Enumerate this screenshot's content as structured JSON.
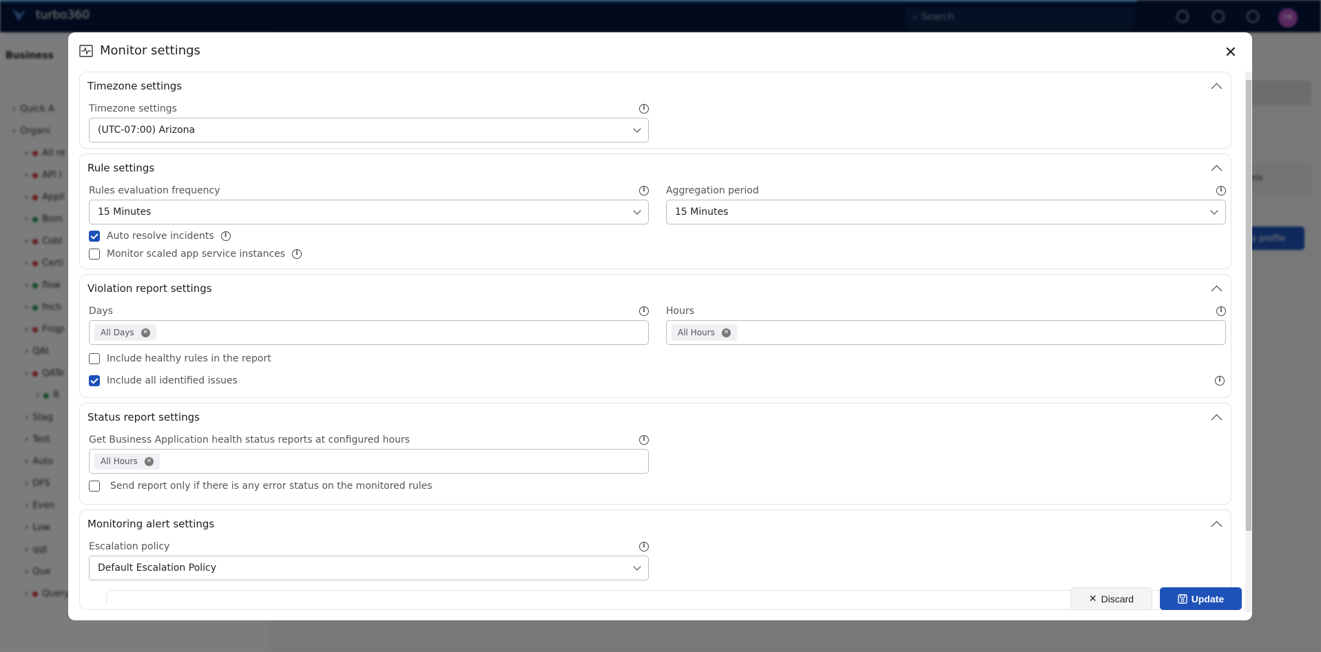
{
  "app": {
    "brand": "turbo360",
    "search_placeholder": "Search",
    "avatar_initials": "SB",
    "accent_color": "#1f52b8",
    "topbar_color": "#03163a"
  },
  "background": {
    "sidebar_title": "Business",
    "sidebar_items": [
      {
        "label": "Quick A",
        "status": "none"
      },
      {
        "label": "Organi",
        "status": "none"
      },
      {
        "label": "All re",
        "status": "red"
      },
      {
        "label": "API I",
        "status": "red"
      },
      {
        "label": "Appli",
        "status": "red"
      },
      {
        "label": "Bom",
        "status": "green"
      },
      {
        "label": "Cobl",
        "status": "red"
      },
      {
        "label": "Certi",
        "status": "red"
      },
      {
        "label": "flow",
        "status": "green"
      },
      {
        "label": "fnch",
        "status": "green"
      },
      {
        "label": "Fnqp",
        "status": "red"
      },
      {
        "label": "QAt",
        "status": "none"
      },
      {
        "label": "QATe",
        "status": "red"
      },
      {
        "label": "R",
        "status": "green"
      },
      {
        "label": "Stag",
        "status": "none"
      },
      {
        "label": "Test",
        "status": "none"
      },
      {
        "label": "Auto",
        "status": "none"
      },
      {
        "label": "DFS",
        "status": "none"
      },
      {
        "label": "Even",
        "status": "none"
      },
      {
        "label": "Low",
        "status": "none"
      },
      {
        "label": "qqt",
        "status": "none"
      },
      {
        "label": "Que",
        "status": "none"
      },
      {
        "label": "Querymonitoring",
        "status": "red"
      }
    ],
    "right_header": "tions",
    "right_button": "ly profile"
  },
  "dialog": {
    "title": "Monitor settings",
    "sections": {
      "timezone": {
        "title": "Timezone settings",
        "field_label": "Timezone settings",
        "value": "(UTC-07:00) Arizona"
      },
      "rule": {
        "title": "Rule settings",
        "frequency_label": "Rules evaluation frequency",
        "frequency_value": "15 Minutes",
        "aggregation_label": "Aggregation period",
        "aggregation_value": "15 Minutes",
        "auto_resolve_label": "Auto resolve incidents",
        "auto_resolve_checked": true,
        "scaled_label": "Monitor scaled app service instances",
        "scaled_checked": false
      },
      "violation": {
        "title": "Violation report settings",
        "days_label": "Days",
        "days_tags": [
          "All Days"
        ],
        "hours_label": "Hours",
        "hours_tags": [
          "All Hours"
        ],
        "healthy_label": "Include healthy rules in the report",
        "healthy_checked": false,
        "issues_label": "Include all identified issues",
        "issues_checked": true
      },
      "status": {
        "title": "Status report settings",
        "hours_label": "Get Business Application health status reports at configured hours",
        "hours_tags": [
          "All Hours"
        ],
        "error_only_label": "Send report only if there is any error status on the monitored rules",
        "error_only_checked": false
      },
      "alert": {
        "title": "Monitoring alert settings",
        "policy_label": "Escalation policy",
        "policy_value": "Default Escalation Policy"
      }
    },
    "footer": {
      "discard_label": "Discard",
      "update_label": "Update"
    }
  }
}
